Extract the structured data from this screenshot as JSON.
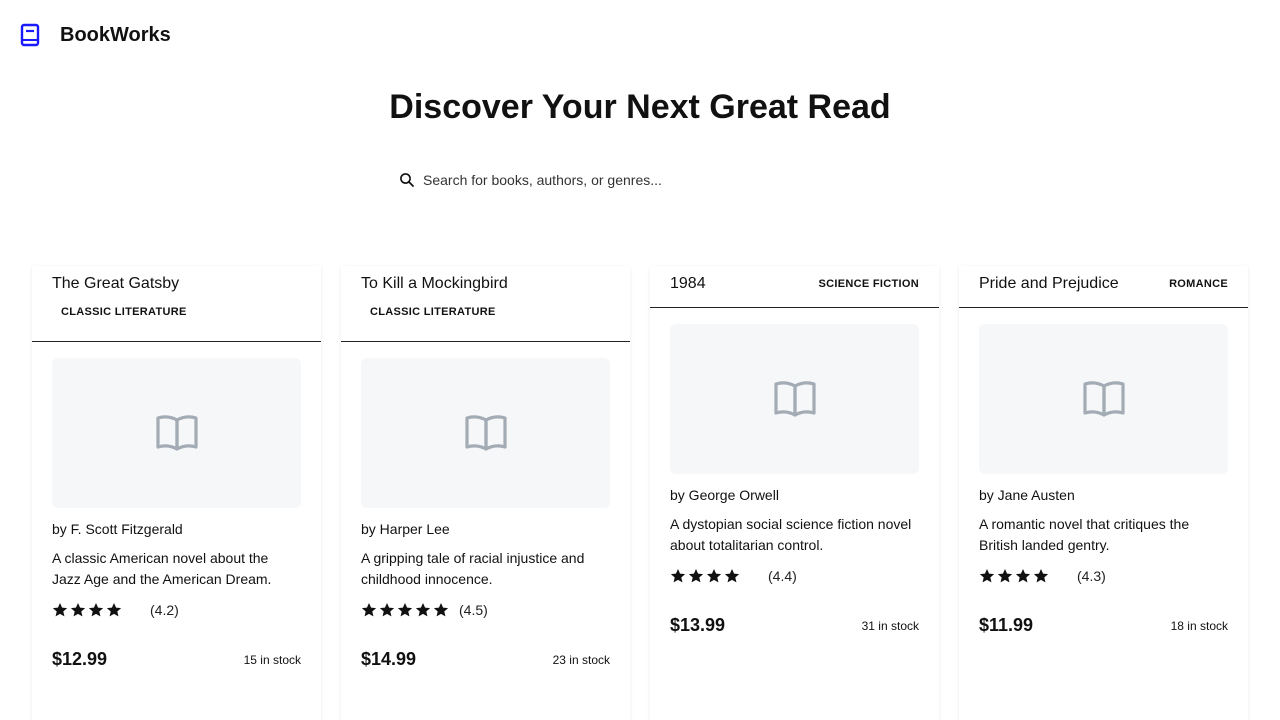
{
  "brand": {
    "name": "BookWorks",
    "icon": "book-icon"
  },
  "hero": {
    "title": "Discover Your Next Great Read"
  },
  "search": {
    "placeholder": "Search for books, authors, or genres..."
  },
  "colors": {
    "accent": "#1a1aff",
    "cover_bg": "#f6f7f9",
    "cover_icon": "#a3abb5"
  },
  "books": [
    {
      "title": "The Great Gatsby",
      "genre": "CLASSIC LITERATURE",
      "author": "by F. Scott Fitzgerald",
      "description": "A classic American novel about the Jazz Age and the American Dream.",
      "stars": 4,
      "rating": "(4.2)",
      "price": "$12.99",
      "stock": "15 in stock"
    },
    {
      "title": "To Kill a Mockingbird",
      "genre": "CLASSIC LITERATURE",
      "author": "by Harper Lee",
      "description": "A gripping tale of racial injustice and childhood innocence.",
      "stars": 5,
      "rating": "(4.5)",
      "price": "$14.99",
      "stock": "23 in stock"
    },
    {
      "title": "1984",
      "genre": "SCIENCE FICTION",
      "author": "by George Orwell",
      "description": "A dystopian social science fiction novel about totalitarian control.",
      "stars": 4,
      "rating": "(4.4)",
      "price": "$13.99",
      "stock": "31 in stock"
    },
    {
      "title": "Pride and Prejudice",
      "genre": "ROMANCE",
      "author": "by Jane Austen",
      "description": "A romantic novel that critiques the British landed gentry.",
      "stars": 4,
      "rating": "(4.3)",
      "price": "$11.99",
      "stock": "18 in stock"
    }
  ]
}
